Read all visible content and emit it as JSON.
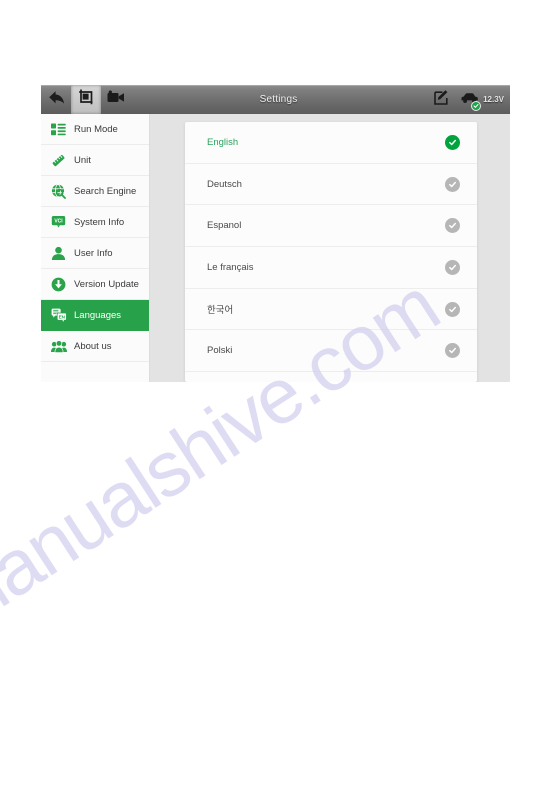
{
  "toolbar": {
    "title": "Settings",
    "back_icon": "back-arrow-icon",
    "screenshot_icon": "screenshot-crop-icon",
    "record_icon": "video-camera-icon",
    "edit_icon": "edit-pencil-icon",
    "vci_icon": "vehicle-connection-icon",
    "voltage": "12.3V",
    "accent_color": "#27a24b"
  },
  "sidebar": {
    "items": [
      {
        "label": "Run Mode",
        "icon": "run-mode-icon",
        "active": false
      },
      {
        "label": "Unit",
        "icon": "ruler-unit-icon",
        "active": false
      },
      {
        "label": "Search Engine",
        "icon": "globe-search-icon",
        "active": false
      },
      {
        "label": "System Info",
        "icon": "vci-badge-icon",
        "active": false
      },
      {
        "label": "User Info",
        "icon": "user-person-icon",
        "active": false
      },
      {
        "label": "Version Update",
        "icon": "download-arrow-icon",
        "active": false
      },
      {
        "label": "Languages",
        "icon": "language-bubble-icon",
        "active": true
      },
      {
        "label": "About us",
        "icon": "people-group-icon",
        "active": false
      }
    ]
  },
  "language_list": {
    "items": [
      {
        "name": "English",
        "selected": true
      },
      {
        "name": "Deutsch",
        "selected": false
      },
      {
        "name": "Espanol",
        "selected": false
      },
      {
        "name": "Le français",
        "selected": false
      },
      {
        "name": "한국어",
        "selected": false
      },
      {
        "name": "Polski",
        "selected": false
      }
    ]
  },
  "watermark": {
    "text": "manualshive.com",
    "color": "#c9c8ec"
  }
}
